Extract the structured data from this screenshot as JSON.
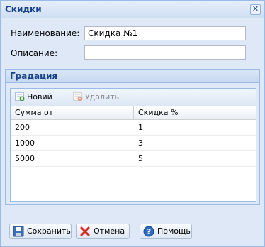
{
  "window": {
    "title": "Скидки"
  },
  "form": {
    "name_label": "Наименование:",
    "name_value": "Скидка №1",
    "description_label": "Описание:",
    "description_value": ""
  },
  "gradation": {
    "title": "Градация",
    "toolbar": {
      "new_label": "Новий",
      "delete_label": "Удалить"
    },
    "columns": [
      "Сумма от",
      "Скидка %"
    ],
    "rows": [
      [
        "200",
        "1"
      ],
      [
        "1000",
        "3"
      ],
      [
        "5000",
        "5"
      ]
    ]
  },
  "footer": {
    "save_label": "Сохранить",
    "cancel_label": "Отмена",
    "help_label": "Помощь"
  },
  "colors": {
    "accent": "#15428b",
    "panel_bg": "#dfe8f6",
    "border": "#99bbe8"
  }
}
